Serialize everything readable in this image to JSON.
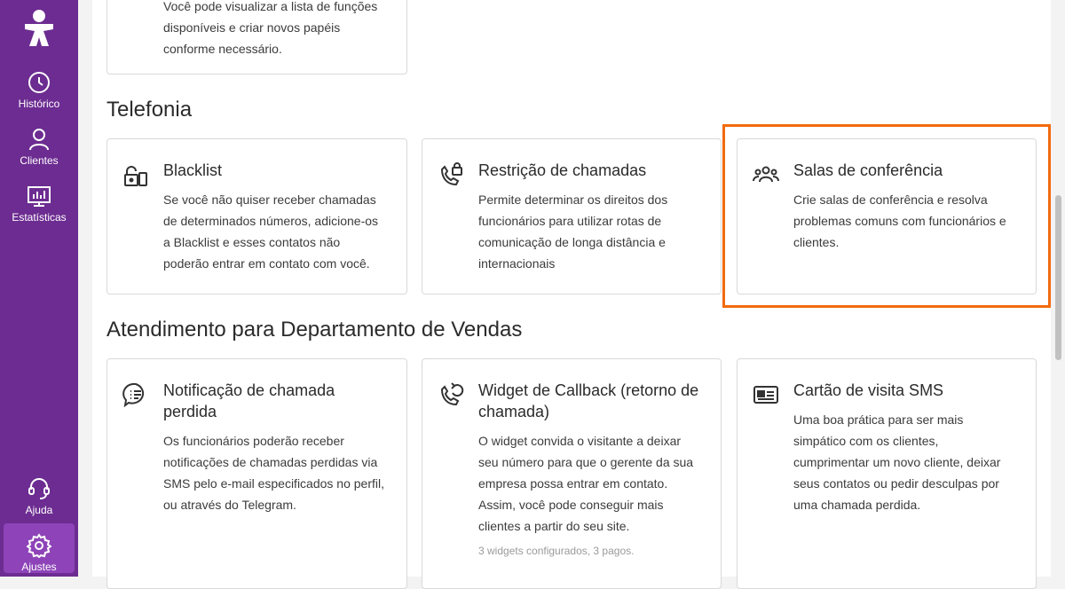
{
  "sidebar": {
    "items": [
      {
        "label": "Histórico",
        "icon": "clock-icon"
      },
      {
        "label": "Clientes",
        "icon": "person-icon"
      },
      {
        "label": "Estatísticas",
        "icon": "chart-icon"
      },
      {
        "label": "Ajuda",
        "icon": "headset-icon"
      },
      {
        "label": "Ajustes",
        "icon": "gear-icon",
        "active": true
      }
    ]
  },
  "top_card": {
    "lines": [
      "Você pode visualizar a lista de funções",
      "disponíveis e criar novos papéis",
      "conforme necessário."
    ]
  },
  "sections": {
    "telefonia": {
      "title": "Telefonia",
      "cards": [
        {
          "title": "Blacklist",
          "icon": "lock-phone-icon",
          "desc": [
            "Se você não quiser receber chamadas",
            "de determinados números, adicione-os",
            "a Blacklist e esses contatos não",
            "poderão entrar em contato com você."
          ]
        },
        {
          "title": "Restrição de chamadas",
          "icon": "phone-lock-icon",
          "desc": [
            "Permite determinar os direitos dos",
            "funcionários para utilizar rotas de",
            "comunicação de longa distância e",
            "internacionais"
          ]
        },
        {
          "title": "Salas de conferência",
          "icon": "group-icon",
          "desc": [
            "Crie salas de conferência e resolva",
            "problemas comuns com funcionários e",
            "clientes."
          ]
        }
      ]
    },
    "vendas": {
      "title": "Atendimento para Departamento de Vendas",
      "cards": [
        {
          "title": [
            "Notificação de chamada",
            "perdida"
          ],
          "icon": "chat-bubble-icon",
          "desc": [
            "Os funcionários poderão receber",
            "notificações de chamadas perdidas via",
            "SMS pelo e-mail especificados no perfil,",
            "ou através do Telegram."
          ]
        },
        {
          "title": [
            "Widget de Callback (retorno de",
            "chamada)"
          ],
          "icon": "callback-icon",
          "desc": [
            "O widget convida o visitante a deixar",
            "seu número para que o gerente da sua",
            "empresa possa entrar em contato.",
            "Assim, você pode conseguir mais",
            "clientes a partir do seu site."
          ],
          "meta": "3 widgets configurados, 3 pagos."
        },
        {
          "title": "Cartão de visita SMS",
          "icon": "id-card-icon",
          "desc": [
            "Uma boa prática para ser mais",
            "simpático com os clientes,",
            "cumprimentar um novo cliente, deixar",
            "seus contatos ou pedir desculpas por",
            "uma chamada perdida."
          ]
        }
      ]
    }
  },
  "colors": {
    "sidebar": "#6c2c91",
    "active": "#8e44b8",
    "highlight": "#f26b0f"
  }
}
